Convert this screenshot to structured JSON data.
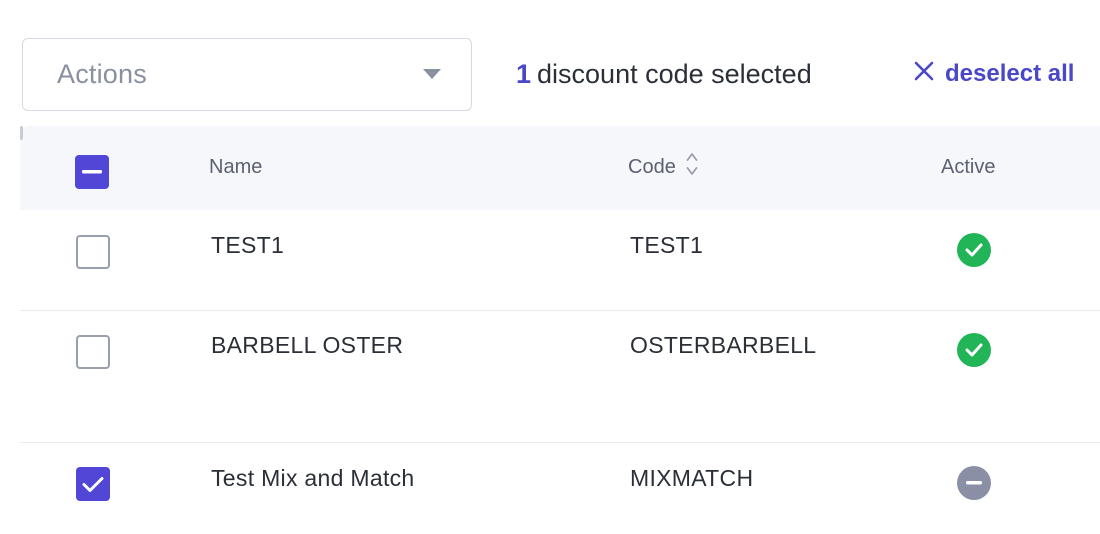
{
  "toolbar": {
    "actions_placeholder": "Actions",
    "selected_count": "1",
    "selected_text": "discount code selected",
    "deselect_label": "deselect all"
  },
  "table": {
    "columns": {
      "name": "Name",
      "code": "Code",
      "active": "Active"
    },
    "header_checkbox_state": "indeterminate",
    "rows": [
      {
        "name": "TEST1",
        "code": "TEST1",
        "active": true,
        "selected": false
      },
      {
        "name": "BARBELL OSTER",
        "code": "OSTERBARBELL",
        "active": true,
        "selected": false
      },
      {
        "name": "Test Mix and Match",
        "code": "MIXMATCH",
        "active": false,
        "selected": true
      }
    ]
  },
  "colors": {
    "accent": "#5146d6",
    "link": "#4b47c9",
    "active_green": "#22b557",
    "inactive_gray": "#8b8fa6",
    "header_bg": "#f6f7fa"
  },
  "icons": {
    "dropdown": "chevron-down-icon",
    "deselect": "close-icon",
    "sort": "sort-icon",
    "active": "check-circle-icon",
    "inactive": "minus-circle-icon"
  }
}
